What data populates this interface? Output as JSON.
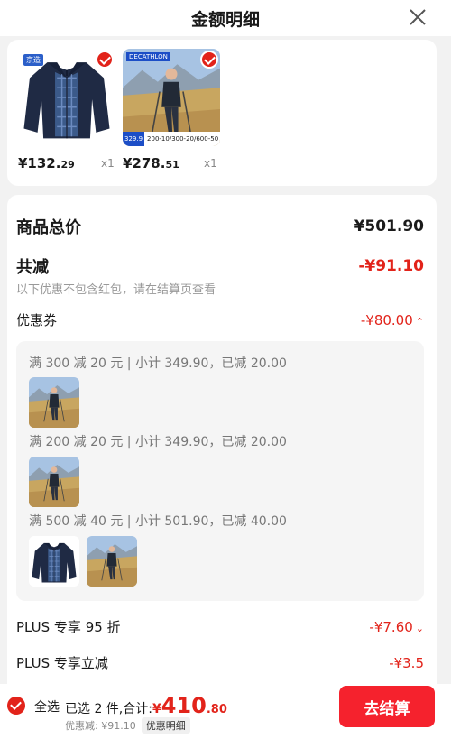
{
  "header": {
    "title": "金额明细"
  },
  "products": [
    {
      "price_int": "¥132.",
      "price_dec": "29",
      "qty": "x1",
      "brand": "京造"
    },
    {
      "price_int": "¥278.",
      "price_dec": "51",
      "qty": "x1",
      "brand": "DECATHLON",
      "promo_price": "329.9",
      "promo_text": "200-10/300-20/600-50"
    }
  ],
  "summary": {
    "total_label": "商品总价",
    "total_value": "¥501.90",
    "reduce_label": "共减",
    "reduce_value": "-¥91.10",
    "note": "以下优惠不包含红包，请在结算页查看"
  },
  "coupon": {
    "label": "优惠券",
    "value": "-¥80.00",
    "groups": [
      {
        "title": "满 300 减 20 元 | 小计 349.90，已减 20.00"
      },
      {
        "title": "满 200 减 20 元 | 小计 349.90，已减 20.00"
      },
      {
        "title": "满 500 减 40 元 | 小计 501.90，已减 40.00"
      }
    ]
  },
  "plus_discount": {
    "label": "PLUS 专享 95 折",
    "value": "-¥7.60"
  },
  "plus_reduce": {
    "label": "PLUS 专享立减",
    "value": "-¥3.5"
  },
  "bottom": {
    "select_all": "全选",
    "selected": "已选 2 件,合计:",
    "total_cur": "¥",
    "total_int": "410",
    "total_dec": ".80",
    "discount": "优惠减: ¥91.10",
    "detail_tag": "优惠明细",
    "checkout": "去结算"
  },
  "colors": {
    "accent": "#e2231a",
    "checkout_bg": "#f5222d"
  },
  "icons": {
    "close": "close-icon",
    "check": "check-icon",
    "chevron": "chevron-icon"
  }
}
